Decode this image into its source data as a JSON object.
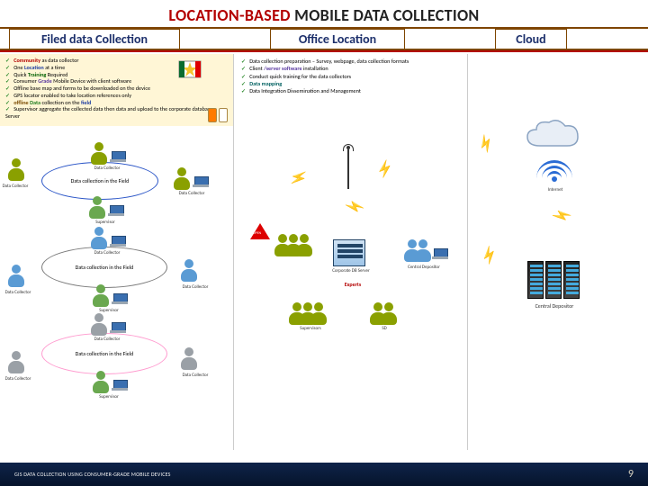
{
  "title": {
    "left": "LOCATION-BASED",
    "right": "MOBILE DATA COLLECTION"
  },
  "headers": {
    "filed": "Filed data Collection",
    "office": "Office Location",
    "cloud": "Cloud"
  },
  "ybox": {
    "i1a": "Community",
    "i1b": " as data collector",
    "i2a": "One ",
    "i2b": "Location",
    "i2c": " at a time",
    "i3a": "Quick ",
    "i3b": "Training",
    "i3c": " Required",
    "i4a": "Consumer ",
    "i4b": "Grade",
    "i4c": " Mobile Device with client software",
    "i5": "Offline base map and forms to be downloaded on the device",
    "i6": "GPS locator enabled to take location references only",
    "i7a": "offline ",
    "i7b": " collection on the ",
    "i7c": "field",
    "i8": "Supervisor aggregate the collected data then data and upload to the corporate database Server"
  },
  "office": {
    "i1": "Data collection preparation – Survey, webpage, data collection formats",
    "i2a": "Client ",
    "i2b": "/server software",
    "i2c": " installation",
    "i3": "Conduct quick training for the data collectors",
    "i4": "Data mapping",
    "i5": "Data Integration Dissemination and Management"
  },
  "ellipses": {
    "e": "Data collection in the Field"
  },
  "roles": {
    "collector": "Data Collector",
    "supervisor": "Supervisor",
    "supervisors": "Supervisors",
    "experts": "Experts",
    "corpserver": "Corporate DB Server",
    "internet": "Internet",
    "depositor": "Central Depositor",
    "sd": "SD"
  },
  "footer": {
    "text": "GIS DATA COLLECTION USING CONSUMER-GRADE MOBILE DEVICES",
    "page": "9"
  }
}
